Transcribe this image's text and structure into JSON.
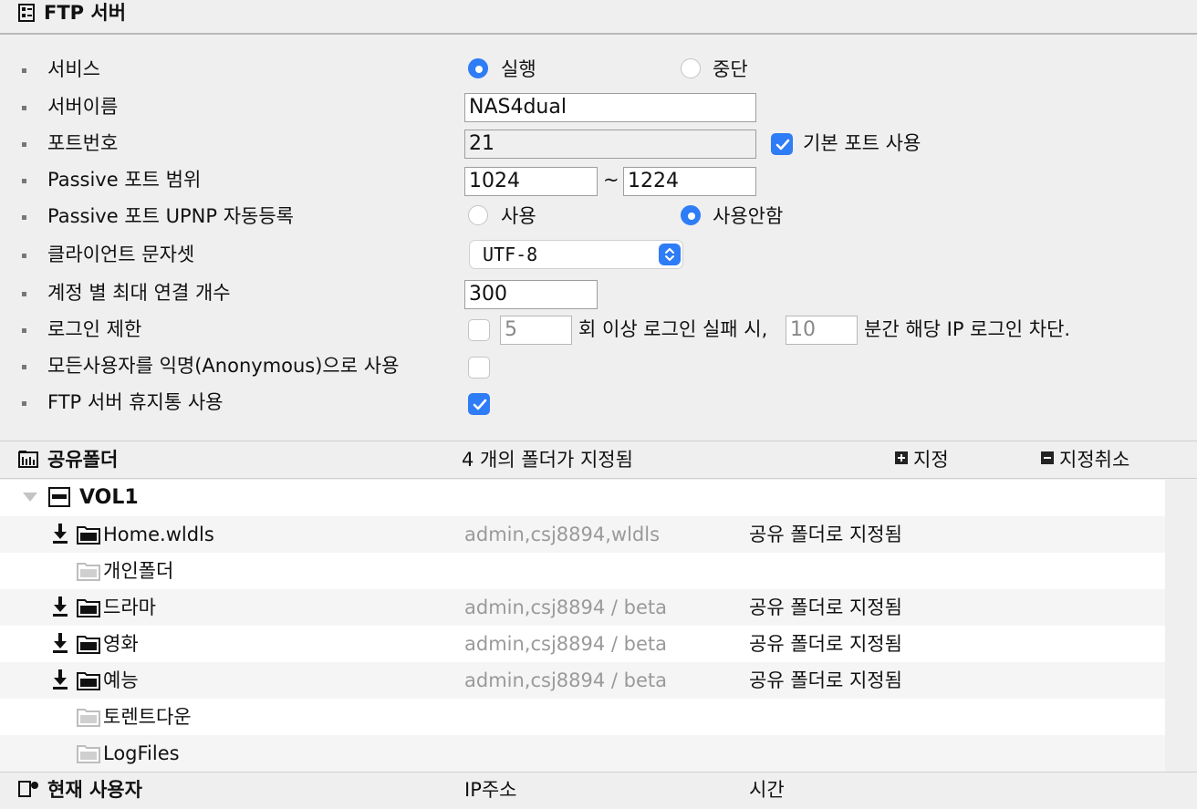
{
  "header": {
    "title": "FTP 서버",
    "icon": "server-settings-icon"
  },
  "settings": {
    "service": {
      "label": "서비스",
      "option_run": "실행",
      "option_stop": "중단",
      "selected": "실행"
    },
    "server_name": {
      "label": "서버이름",
      "value": "NAS4dual"
    },
    "port": {
      "label": "포트번호",
      "value": "21",
      "default_port_label": "기본 포트 사용",
      "default_port_checked": true
    },
    "passive_range": {
      "label": "Passive 포트 범위",
      "from": "1024",
      "sep": "~",
      "to": "1224"
    },
    "upnp": {
      "label": "Passive 포트 UPNP 자동등록",
      "option_use": "사용",
      "option_nouse": "사용안함",
      "selected": "사용안함"
    },
    "charset": {
      "label": "클라이언트 문자셋",
      "value": "UTF-8"
    },
    "max_conn": {
      "label": "계정 별 최대 연결 개수",
      "value": "300"
    },
    "login_limit": {
      "label": "로그인 제한",
      "checked": false,
      "attempts": "5",
      "text1": "회 이상 로그인 실패 시,",
      "minutes": "10",
      "text2": "분간 해당 IP 로그인 차단."
    },
    "anonymous": {
      "label": "모든사용자를 익명(Anonymous)으로 사용",
      "checked": false
    },
    "trash": {
      "label": "FTP 서버 휴지통 사용",
      "checked": true
    }
  },
  "shared": {
    "title": "공유폴더",
    "count_text": "4  개의 폴더가 지정됨",
    "assign_label": "지정",
    "unassign_label": "지정취소",
    "volume": "VOL1",
    "folders": [
      {
        "name": "Home.wldls",
        "owners": "admin,csj8894,wldls",
        "status": "공유 폴더로 지정됨",
        "assigned": true
      },
      {
        "name": "개인폴더",
        "owners": "",
        "status": "",
        "assigned": false
      },
      {
        "name": "드라마",
        "owners": "admin,csj8894 / beta",
        "status": "공유 폴더로 지정됨",
        "assigned": true
      },
      {
        "name": "영화",
        "owners": "admin,csj8894 / beta",
        "status": "공유 폴더로 지정됨",
        "assigned": true
      },
      {
        "name": "예능",
        "owners": "admin,csj8894 / beta",
        "status": "공유 폴더로 지정됨",
        "assigned": true
      },
      {
        "name": "토렌트다운",
        "owners": "",
        "status": "",
        "assigned": false
      },
      {
        "name": "LogFiles",
        "owners": "",
        "status": "",
        "assigned": false
      }
    ]
  },
  "bottom": {
    "col1": "현재 사용자",
    "col2": "IP주소",
    "col3": "시간"
  },
  "colors": {
    "accent": "#2e7cf6",
    "background": "#efefef"
  }
}
